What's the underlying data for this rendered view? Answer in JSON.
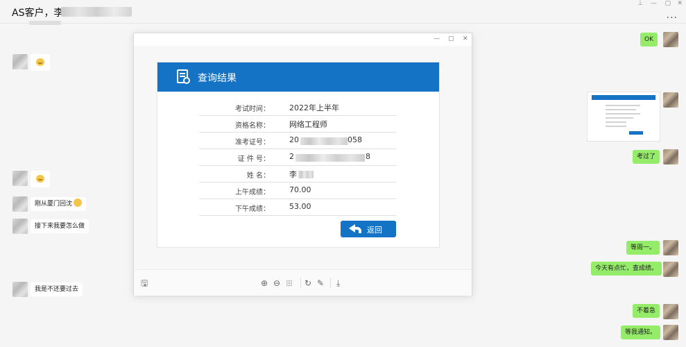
{
  "chat": {
    "title": "AS客户，李",
    "more_label": "..."
  },
  "messages": {
    "ok": "OK",
    "kaoguo": "考过了",
    "c1": "刚从厦门回沈",
    "c2": "接下来我要怎么做",
    "dengzhou": "等周一。",
    "jintian": "今天有点忙，查成绩。",
    "c3": "我是不还要过去",
    "bujizhe": "不着急",
    "dengtongzhi": "等我通知。"
  },
  "result": {
    "title": "查询结果",
    "back_label": "返回",
    "rows": [
      {
        "label": "考试时间：",
        "value": "2022年上半年"
      },
      {
        "label": "资格名称：",
        "value": "网络工程师"
      },
      {
        "label": "准考证号：",
        "value": "20",
        "suffix": "058"
      },
      {
        "label": "证 件  号：",
        "value": "2",
        "suffix": "8"
      },
      {
        "label": "姓       名：",
        "value": "李"
      },
      {
        "label": "上午成绩：",
        "value": "70.00"
      },
      {
        "label": "下午成绩：",
        "value": "53.00"
      }
    ]
  },
  "icons": {
    "window": [
      "minimize-icon",
      "maximize-icon",
      "close-icon"
    ],
    "viewer_tools": [
      "save-icon",
      "zoom-in-icon",
      "zoom-out-icon",
      "fit-icon",
      "rotate-icon",
      "edit-icon",
      "download-icon"
    ]
  },
  "colors": {
    "brand_blue": "#1473c5",
    "outgoing_bubble": "#95ec69",
    "incoming_bubble": "#ffffff"
  }
}
